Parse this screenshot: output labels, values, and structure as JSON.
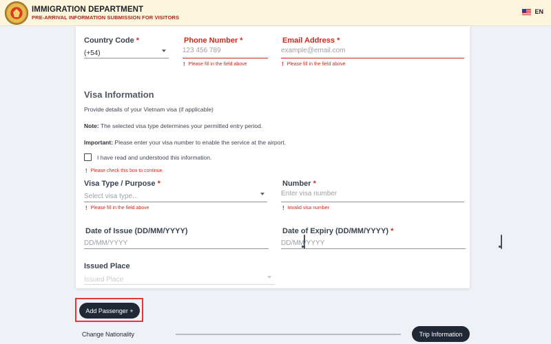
{
  "header": {
    "title": "IMMIGRATION DEPARTMENT",
    "subtitle": "PRE-ARRIVAL INFORMATION SUBMISSION FOR VISITORS",
    "language": "EN"
  },
  "contact": {
    "country_code_label": "Country Code",
    "country_code_value": "(+54)",
    "phone_label": "Phone Number",
    "phone_placeholder": "123 456 789",
    "phone_error": "Please fill in the field above",
    "email_label": "Email Address",
    "email_placeholder": "example@email.com",
    "email_error": "Please fill in the field above"
  },
  "visa": {
    "section_title": "Visa Information",
    "description": "Provide details of your Vietnam visa (if applicable)",
    "note_label": "Note:",
    "note_text": "The selected visa type determines your permitted entry period.",
    "important_label": "Important:",
    "important_text": "Please enter your visa number to enable the service at the airport.",
    "checkbox_label": "I have read and understood this information.",
    "checkbox_error": "Please check this box to continue.",
    "type_label": "Visa Type / Purpose",
    "type_placeholder": "Select visa type...",
    "type_error": "Please fill in the field above",
    "number_label": "Number",
    "number_placeholder": "Enter visa number",
    "number_error": "Invalid visa number",
    "issue_label": "Date of Issue (DD/MM/YYYY)",
    "issue_placeholder": "DD/MM/YYYY",
    "expiry_label": "Date of Expiry (DD/MM/YYYY)",
    "expiry_placeholder": "DD/MM/YYYY",
    "place_label": "Issued Place",
    "place_placeholder": "Issued Place"
  },
  "required_mark": "*",
  "error_mark": "!",
  "footer": {
    "add_passenger": "Add Passenger +",
    "change_nationality": "Change Nationality",
    "trip_information": "Trip Information"
  },
  "colors": {
    "header_bg": "#fdf5dd",
    "error_red": "#d0281c",
    "button_dark": "#202836",
    "highlight_frame": "#e23a32"
  }
}
